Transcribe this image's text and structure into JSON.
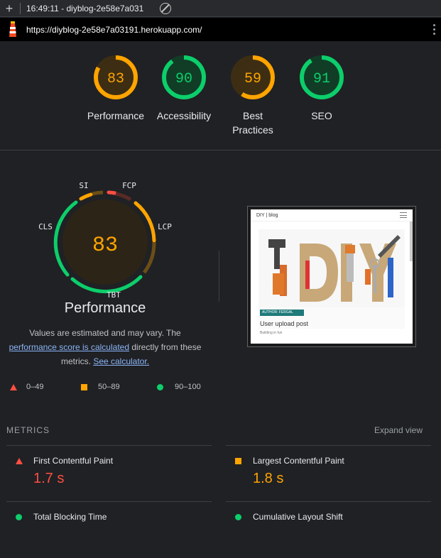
{
  "toolbar": {
    "new_label": "+",
    "session": "16:49:11 - diyblog-2e58e7a031",
    "caret": "▼"
  },
  "urlbar": {
    "url": "https://diyblog-2e58e7a03191.herokuapp.com/"
  },
  "scores": [
    {
      "label": "Performance",
      "score": 83,
      "status": "average"
    },
    {
      "label": "Accessibility",
      "score": 90,
      "status": "pass"
    },
    {
      "label": "Best Practices",
      "score": 59,
      "status": "average"
    },
    {
      "label": "SEO",
      "score": 91,
      "status": "pass"
    }
  ],
  "colors": {
    "pass": "#0cce6b",
    "average": "#ffa400",
    "fail": "#ff4e42",
    "pass_bg": "#113d27",
    "average_bg": "#3d2e13",
    "fail_bg": "#3d1e1c"
  },
  "performance": {
    "score": "83",
    "title": "Performance",
    "segments": {
      "si": "SI",
      "fcp": "FCP",
      "lcp": "LCP",
      "tbt": "TBT",
      "cls": "CLS"
    },
    "desc_line1": "Values are estimated and may vary. The",
    "desc_link1": "performance score is calculated",
    "desc_mid": " directly from these",
    "desc_line3": "metrics. ",
    "desc_link2": "See calculator."
  },
  "screenshot": {
    "brand": "DIY | blog",
    "author": "AUTHOR: FERGAL",
    "post_title": "User upload post",
    "post_sub": "Building in fun"
  },
  "legend": {
    "fail": "0–49",
    "average": "50–89",
    "pass": "90–100"
  },
  "metrics": {
    "heading": "METRICS",
    "expand": "Expand view",
    "items": [
      {
        "name": "First Contentful Paint",
        "value": "1.7 s",
        "status": "fail"
      },
      {
        "name": "Largest Contentful Paint",
        "value": "1.8 s",
        "status": "average"
      },
      {
        "name": "Total Blocking Time",
        "value": "",
        "status": "pass"
      },
      {
        "name": "Cumulative Layout Shift",
        "value": "",
        "status": "pass"
      }
    ]
  }
}
